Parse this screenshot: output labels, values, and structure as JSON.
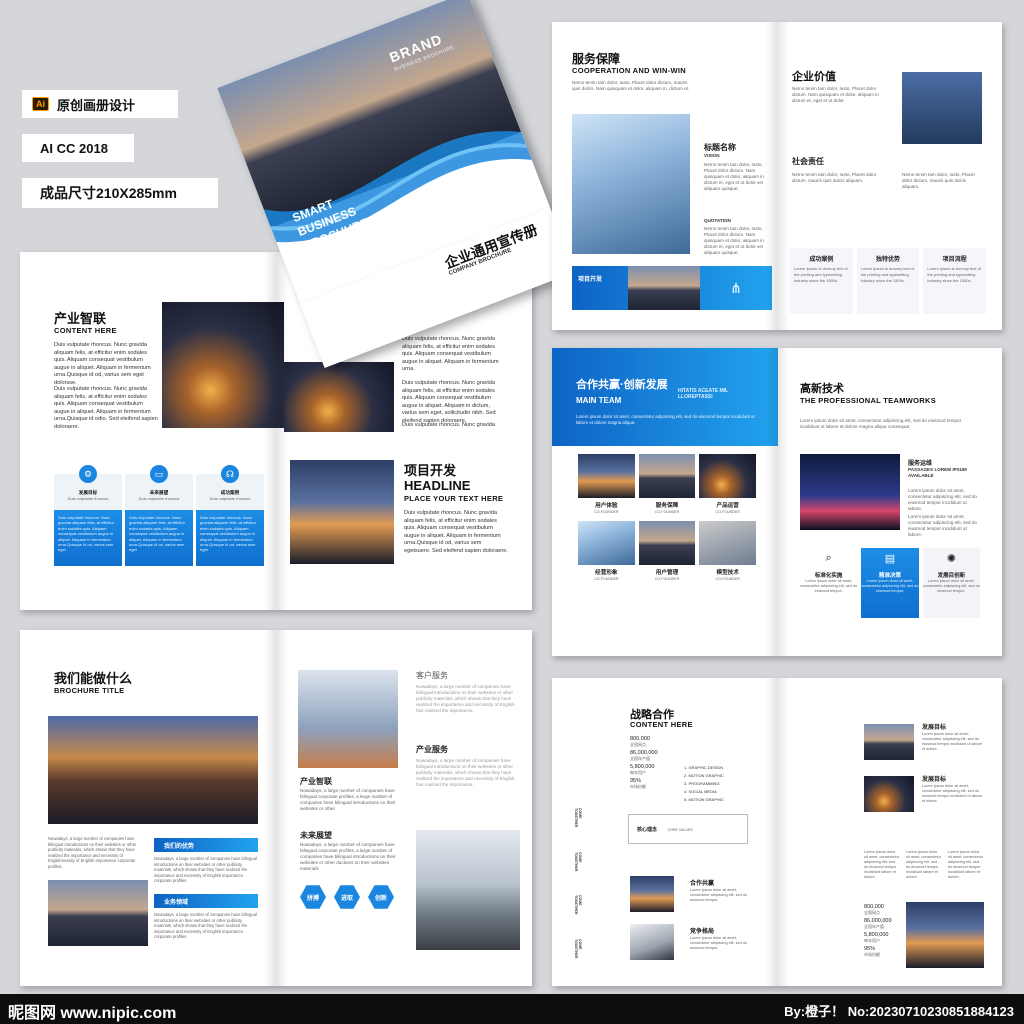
{
  "labels": {
    "ai_badge": "Ai",
    "title": "原创画册设计",
    "version": "AI CC 2018",
    "size": "成品尺寸210X285mm"
  },
  "cover": {
    "brand": "BRAND",
    "brand_sub": "BUSINESS BROCHURE",
    "line1": "SMART",
    "line2": "BUSINESS",
    "line3": "BROCHURE",
    "cn_title": "企业通用宣传册",
    "en_title": "COMPANY BROCHURE"
  },
  "s1": {
    "title": "产业智联",
    "sub": "CONTENT HERE",
    "p1": "Duis vulputate rhoncus. Nunc gravida aliquam felis, at efficitur enim sodales quis. Aliquam consequat vestibulum augue in aliquet. Aliquam in fermentum urna.Quisque id od, varius sem eget dolorsse.",
    "p2": "Duis vulputate rhoncus. Nunc gravida aliquam felis, at efficitur enim sodales quis. Aliquam consequat vestibulum augue in aliquet. Aliquam in fermentum urna.Quisque id odio. Sed eleifend sapien doloraere.",
    "boxes": [
      {
        "title": "发展目标",
        "sub": "Duis vulputate rhoncus",
        "icon": "gear-icon"
      },
      {
        "title": "未来展望",
        "sub": "Duis vulputate rhoncus",
        "icon": "monitor-icon"
      },
      {
        "title": "成功案例",
        "sub": "Duis vulputate rhoncus",
        "icon": "headset-icon"
      }
    ],
    "box_text": "Duis vulputate rhoncus. Nunc gravida aliquam felis, at efficitur enim sodales quis. Aliquam consequat vestibulum augue in aliquet. Aliquam in fermentum urna.Quisque id od, varius sem eget",
    "right_p1": "Duis vulputate rhoncus. Nunc gravida aliquam felis, at efficitur enim sodales quis. Aliquam consequat vestibulum augue in aliquet. Aliquam in fermentum urna.",
    "right_p2": "Duis vulputate rhoncus. Nunc gravida aliquam felis, at efficitur enim sodales quis. Aliquam consequat vestibulum augue in aliquet. Aliquam in dictum, varius sem eget, sollicitudin nibh. Sed eleifend sapien doloraere.",
    "right_p3": "Duis vulputate rhoncus. Nunc gravida",
    "proj_title": "项目开发",
    "headline": "HEADLINE",
    "headline_sub": "PLACE YOUR TEXT HERE",
    "proj_text": "Duis vulputate rhoncus. Nunc gravida aliquam felis, at efficitur enim sodales quis. Aliquam consequat vestibulum augue in aliquet. Aliquam in fermentum urna.Quisque id od, varius sem egetsuere. Sed eleifend sapien doloraere."
  },
  "s2": {
    "title": "服务保障",
    "sub": "COOPERATION AND WIN-WIN",
    "p": "Nemo tenim tam dolor, Iusto, Placet dolor dictum, mauris quis dulcis. Nam quisquam et dolor, aliquam in, dictum et.",
    "vision_title": "标题名称",
    "vision_sub": "VISION",
    "vision_text": "Nemo tenim tam dolor, Iusto, Placet dolor dictum. Nam quisquam et dolor, aliquam in dictum et, eget et ut dolor vel aliquam quisque.",
    "quotation": "QUOTATION",
    "proj": "项目开发",
    "right_title": "企业价值",
    "right_text": "Nemo tenim tam dolor, Iusto, Placet dolor dictum. Nam quisquam et dolor, aliquam in dictum et, eget et ut dolor.",
    "social_title": "社会责任",
    "social_text": "Nemo tenim tam dolor, Iusto, Placet dolor dictum, mauris quis dulcis aliquam.",
    "cols": [
      {
        "title": "成功案例",
        "text": "Lorem Ipsum is dummy text of the printing and typesetting industry since the 1500s."
      },
      {
        "title": "独特优势",
        "text": "Lorem Ipsum is dummy text of the printing and typesetting industry since the 1500s."
      },
      {
        "title": "项目流程",
        "text": "Lorem Ipsum is dummy text of the printing and typesetting industry since the 1500s."
      }
    ]
  },
  "s3": {
    "title": "合作共赢·创新发展",
    "sub": "MAIN TEAM",
    "band_en": "HITATIS ACEATE MIL LLOREPTASSI",
    "band_text": "Lorem ipsum dolor sit amet, consectetur adipiscing elit, sed do eiusmod tempor incididunt ut labore et dolore magna aliqua.",
    "tiles": [
      {
        "title": "用户体验",
        "sub": "CO-FOUNDER"
      },
      {
        "title": "服务保障",
        "sub": "CO-FOUNDER"
      },
      {
        "title": "产品运营",
        "sub": "CO-FOUNDER"
      },
      {
        "title": "经营形象",
        "sub": "CO-FOUNDER"
      },
      {
        "title": "用户管理",
        "sub": "CO-FOUNDER"
      },
      {
        "title": "模型技术",
        "sub": "CO-FOUNDER"
      }
    ],
    "right_title": "高新技术",
    "right_sub": "THE PROFESSIONAL TEAMWORKS",
    "right_text": "Lorem ipsum dolor sit amet, consectetur adipiscing elit, sed do eiusmod tempor incididunt ut labore et dolore magna aliqua consequat.",
    "svc_title": "服务运维",
    "svc_sub": "PASSAGES LOREM IPSUM AVAILABLE",
    "svc_text": "Lorem ipsum dolor sit amet, consectetur adipiscing elit, sed do eiusmod tempor incididunt ut labore.",
    "svc_text2": "Lorem ipsum dolor sit amet, consectetur adipiscing elit, sed do eiusmod tempor incididunt ut labore.",
    "feats": [
      {
        "title": "标准化实施",
        "icon": "search-icon"
      },
      {
        "title": "精准决策",
        "icon": "book-icon"
      },
      {
        "title": "发展目创新",
        "icon": "bulb-icon"
      }
    ],
    "feat_text": "Lorem ipsum dolor sit amet, consectetur adipiscing elit, sed do eiusmod tempor."
  },
  "s4": {
    "title": "我们能做什么",
    "sub": "BROCHURE TITLE",
    "p": "Nowadays, a large number of companies have bilingual introductions on their websites or other publicity materials, which shows that they have realized the importance and necessity of Englishnessity of English Importance corporate profiles.",
    "tag1": "我们的优势",
    "tag1_text": "Nowadays, a large number of companies have bilingual introductions on their websites or other publicity materials, which shows that they have realized the importance and necessity of English importance corporate profiles",
    "tag2": "业务领域",
    "tag2_text": "Nowadays, a large number of companies have bilingual introductions on their websites or other publicity materials, which shows that they have realized the importance and necessity of English importance corporate profiles",
    "client_title": "客户服务",
    "client_text": "Nowadays, a large number of companies have bilingual introductions on their websites or other publicity materials, which shows that they have realized the importance and necessity of English has realized the importance.",
    "ind_title": "产业服务",
    "ind_text": "Nowadays, a large number of companies have bilingual introductions on their websites or other publicity materials, which shows that they have realized the importance and necessity of English has realized the importance.",
    "smart_title": "产业智联",
    "smart_text": "Nowadays, a large number of companies have bilingual corporate profiles, a large number of companies have bilingual introductions on their websites or other",
    "future_title": "未来展望",
    "future_text": "Nowadays, a large number of companies have bilingual corporate profiles, a large number of companies have bilingual introductions on their websites or other ductions on their websites materials",
    "hex": [
      "拼搏",
      "进取",
      "创新"
    ]
  },
  "s5": {
    "title": "战略合作",
    "sub": "CONTENT HERE",
    "stats": [
      {
        "num": "800,000",
        "label": "全国网点"
      },
      {
        "num": "86,000,000",
        "label": "全国年产值"
      },
      {
        "num": "5,800,000",
        "label": "每年用户"
      },
      {
        "num": "95%",
        "label": "市场份额"
      }
    ],
    "list": [
      "1. GRAPHIC DESIGN",
      "2. MOTION GRAPHIC",
      "3. PROGRAMMING",
      "4. SOCIAL MEDIA",
      "5. MOTION GRAPHIC"
    ],
    "core_title": "核心理念",
    "core_sub": "CORE VALUES",
    "side_labels": [
      "COME TOGETHER",
      "COME TOGETHER",
      "COME TOGETHER",
      "COME TOGETHER",
      "COME TOGETHER"
    ],
    "coop": "合作共赢",
    "compete": "竞争格局",
    "small_text": "Lorem ipsum dolor sit amet, consectetur adipiscing elit, sed do eiusmod tempor.",
    "goal1": "发展目标",
    "goal2": "发展目标",
    "goal_text": "Lorem ipsum dolor sit amet, consectetur adipiscing elit, sed do eiusmod tempor incididunt ut labore et dolore.",
    "col_text": "Lorem ipsum dolor sit amet, consectetur adipiscing elit, sed do eiusmod tempor incididunt labore et dolore.",
    "stats2": [
      {
        "num": "800,000",
        "label": "全国网点"
      },
      {
        "num": "86,000,000",
        "label": "全国年产值"
      },
      {
        "num": "5,800,000",
        "label": "每年用户"
      },
      {
        "num": "95%",
        "label": "市场份额"
      }
    ]
  },
  "footer": {
    "logo": "昵图网 www.nipic.com",
    "credit": "By:橙子！ No:20230710230851884123"
  }
}
